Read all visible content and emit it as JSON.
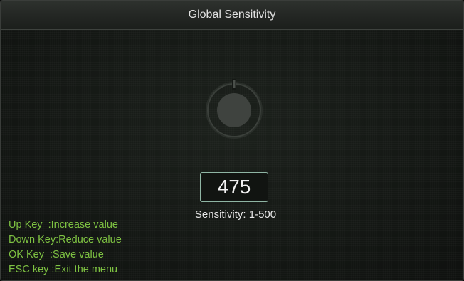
{
  "header": {
    "title": "Global Sensitivity"
  },
  "dial": {
    "icon": "rotary-knob-icon"
  },
  "value": {
    "current": "475",
    "range_label": "Sensitivity: 1-500"
  },
  "help": {
    "items": [
      "Up Key  :Increase value",
      "Down Key:Reduce value",
      "OK Key  :Save value",
      "ESC key :Exit the menu"
    ]
  },
  "colors": {
    "help_text": "#7ec242",
    "value_border": "#8fb5a4",
    "title_text": "#e2e2e2"
  }
}
